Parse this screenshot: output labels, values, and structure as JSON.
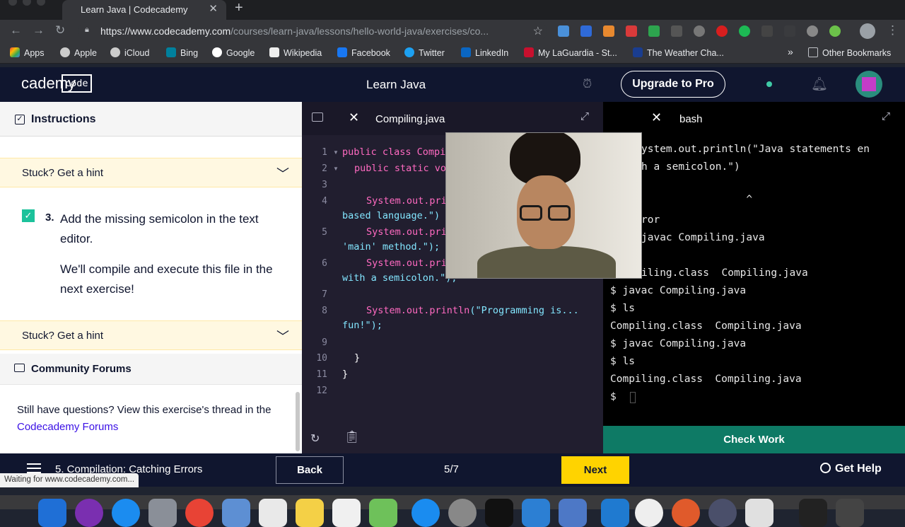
{
  "browser": {
    "tab_title": "Learn Java | Codecademy",
    "url_host": "https://www.codecademy.com",
    "url_path": "/courses/learn-java/lessons/hello-world-java/exercises/co...",
    "bookmarks": [
      "Apps",
      "Apple",
      "iCloud",
      "Bing",
      "Google",
      "Wikipedia",
      "Facebook",
      "Twitter",
      "LinkedIn",
      "My LaGuardia - St...",
      "The Weather Cha..."
    ],
    "other_bookmarks": "Other Bookmarks",
    "overflow": "»",
    "status_text": "Waiting for www.codecademy.com..."
  },
  "header": {
    "logo_code": "code",
    "logo_rest": "cademy",
    "course_title": "Learn Java",
    "upgrade_label": "Upgrade to Pro"
  },
  "instructions": {
    "heading": "Instructions",
    "hint_label": "Stuck? Get a hint",
    "task_number": "3.",
    "task_text": "Add the missing semicolon in the text editor.",
    "task_note": "We'll compile and execute this file in the next exercise!",
    "forum_heading": "Community Forums",
    "forum_text": "Still have questions? View this exercise's thread in the ",
    "forum_link": "Codecademy Forums"
  },
  "editor": {
    "file_name": "Compiling.java",
    "line_numbers": [
      "1",
      "2",
      "3",
      "4",
      "5",
      "6",
      "7",
      "8",
      "9",
      "10",
      "11",
      "12"
    ],
    "lines": {
      "l1": "public class Compi",
      "l2_kw": "public static vo",
      "l4a": "System.out.pri",
      "l4b": "based language.\")",
      "l5a": "System.out.pri",
      "l5b": "'main' method.\");",
      "l6a": "System.out.pri",
      "l6b": "with a semicolon.\");",
      "l8a": "System.out.println",
      "l8b": "(\"Programming is...",
      "l8c": "fun!\");",
      "l10": "}",
      "l11": "}"
    }
  },
  "terminal": {
    "tab_name": "bash",
    "lines": [
      "ystem.out.println(\"Java statements en",
      "h a semicolon.\")",
      "",
      "                 ^",
      "ror",
      "javac Compiling.java",
      "",
      "iling.class  Compiling.java",
      "$ javac Compiling.java",
      "$ ls",
      "Compiling.class  Compiling.java",
      "$ javac Compiling.java",
      "$ ls",
      "Compiling.class  Compiling.java",
      "$ "
    ],
    "check_work_label": "Check Work"
  },
  "bottom_nav": {
    "lesson_name": "5. Compilation: Catching Errors",
    "back_label": "Back",
    "progress": "5/7",
    "next_label": "Next",
    "help_label": "Get Help"
  },
  "colors": {
    "header_bg": "#10162f",
    "next_yellow": "#ffd300",
    "check_work_green": "#0e7a65",
    "task_check_green": "#1cc29b",
    "hint_bg": "#fff8e1",
    "link_blue": "#3a10e5"
  }
}
